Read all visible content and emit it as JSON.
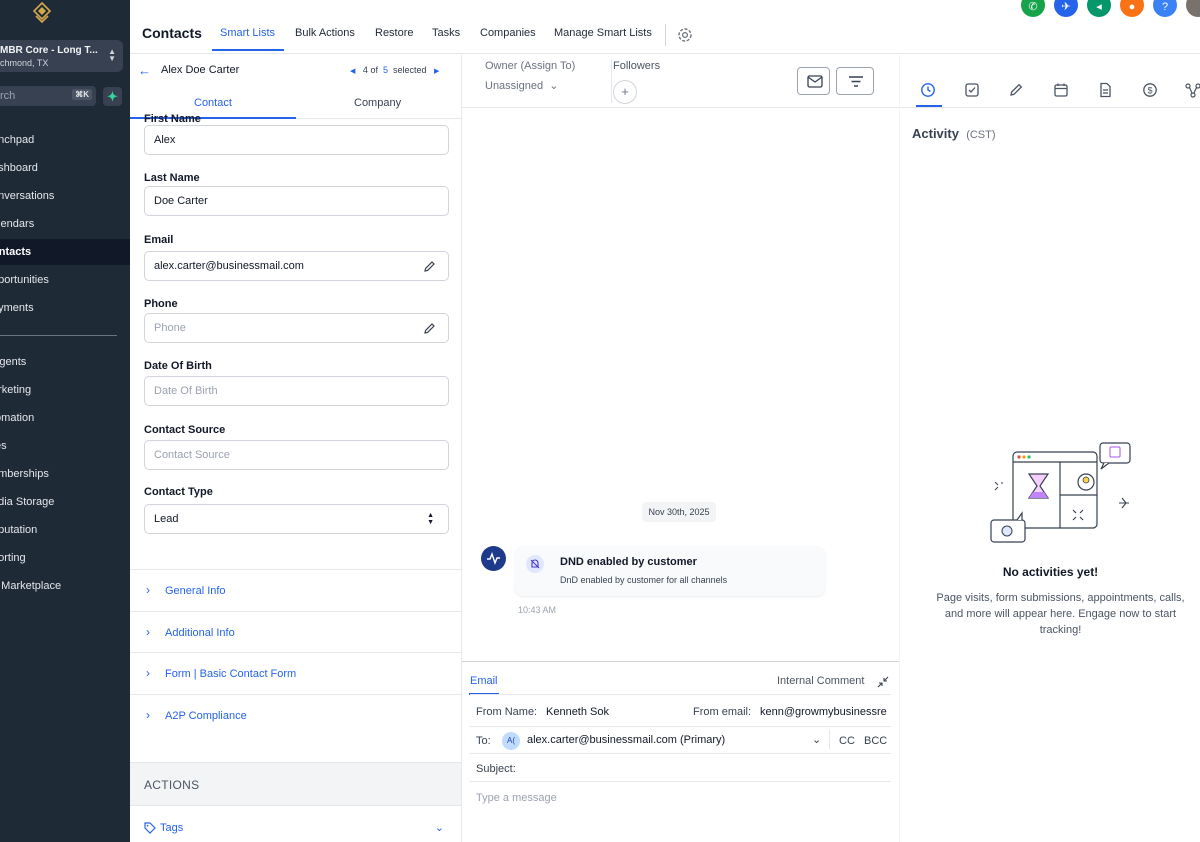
{
  "sidebar": {
    "location_name": "MBR Core - Long T...",
    "location_sub": "chmond, TX",
    "search_placeholder": "rch",
    "search_shortcut": "⌘K",
    "nav": [
      {
        "label": "unchpad"
      },
      {
        "label": "ashboard"
      },
      {
        "label": "onversations"
      },
      {
        "label": "alendars"
      },
      {
        "label": "ontacts"
      },
      {
        "label": "pportunities"
      },
      {
        "label": "ayments"
      },
      {
        "label": "Agents"
      },
      {
        "label": "arketing"
      },
      {
        "label": "tomation"
      },
      {
        "label": "tes"
      },
      {
        "label": "emberships"
      },
      {
        "label": "edia Storage"
      },
      {
        "label": "eputation"
      },
      {
        "label": "porting"
      },
      {
        "label": "p Marketplace"
      }
    ]
  },
  "topbar": {
    "title": "Contacts",
    "tabs": [
      "Smart Lists",
      "Bulk Actions",
      "Restore",
      "Tasks",
      "Companies",
      "Manage Smart Lists"
    ],
    "header_icons": [
      "phone-icon",
      "rocket-icon",
      "megaphone-icon",
      "bell-icon",
      "help-icon"
    ],
    "header_icon_colors": [
      "#16a34a",
      "#2563eb",
      "#059669",
      "#f97316",
      "#3b82f6"
    ]
  },
  "contact": {
    "name": "Alex Doe Carter",
    "pager_current": "4",
    "pager_of": "of",
    "pager_total": "5",
    "pager_selected": "selected",
    "tabs": [
      "Contact",
      "Company"
    ],
    "fields": {
      "first_name_label": "First Name",
      "first_name": "Alex",
      "last_name_label": "Last Name",
      "last_name": "Doe Carter",
      "email_label": "Email",
      "email": "alex.carter@businessmail.com",
      "phone_label": "Phone",
      "phone_placeholder": "Phone",
      "dob_label": "Date Of Birth",
      "dob_placeholder": "Date Of Birth",
      "source_label": "Contact Source",
      "source_placeholder": "Contact Source",
      "type_label": "Contact Type",
      "type_value": "Lead"
    },
    "sections": [
      "General Info",
      "Additional Info",
      "Form | Basic Contact Form",
      "A2P Compliance"
    ],
    "actions_label": "ACTIONS",
    "tags_label": "Tags"
  },
  "conversation": {
    "owner_label": "Owner (Assign To)",
    "owner_value": "Unassigned",
    "followers_label": "Followers",
    "date_pill": "Nov 30th, 2025",
    "event_title": "DND enabled by customer",
    "event_desc": "DnD enabled by customer for all channels",
    "event_time": "10:43 AM",
    "composer": {
      "tab": "Email",
      "internal_comment": "Internal Comment",
      "from_name_label": "From Name:",
      "from_name": "Kenneth Sok",
      "from_email_label": "From email:",
      "from_email": "kenn@growmybusinessre",
      "to_label": "To:",
      "to_avatar": "A(",
      "to_value": "alex.carter@businessmail.com (Primary)",
      "cc": "CC",
      "bcc": "BCC",
      "subject_label": "Subject:",
      "message_placeholder": "Type a message"
    }
  },
  "activity": {
    "title": "Activity",
    "timezone": "(CST)",
    "empty_title": "No activities yet!",
    "empty_desc": "Page visits, form submissions, appointments, calls, and more will appear here. Engage now to start tracking!"
  }
}
